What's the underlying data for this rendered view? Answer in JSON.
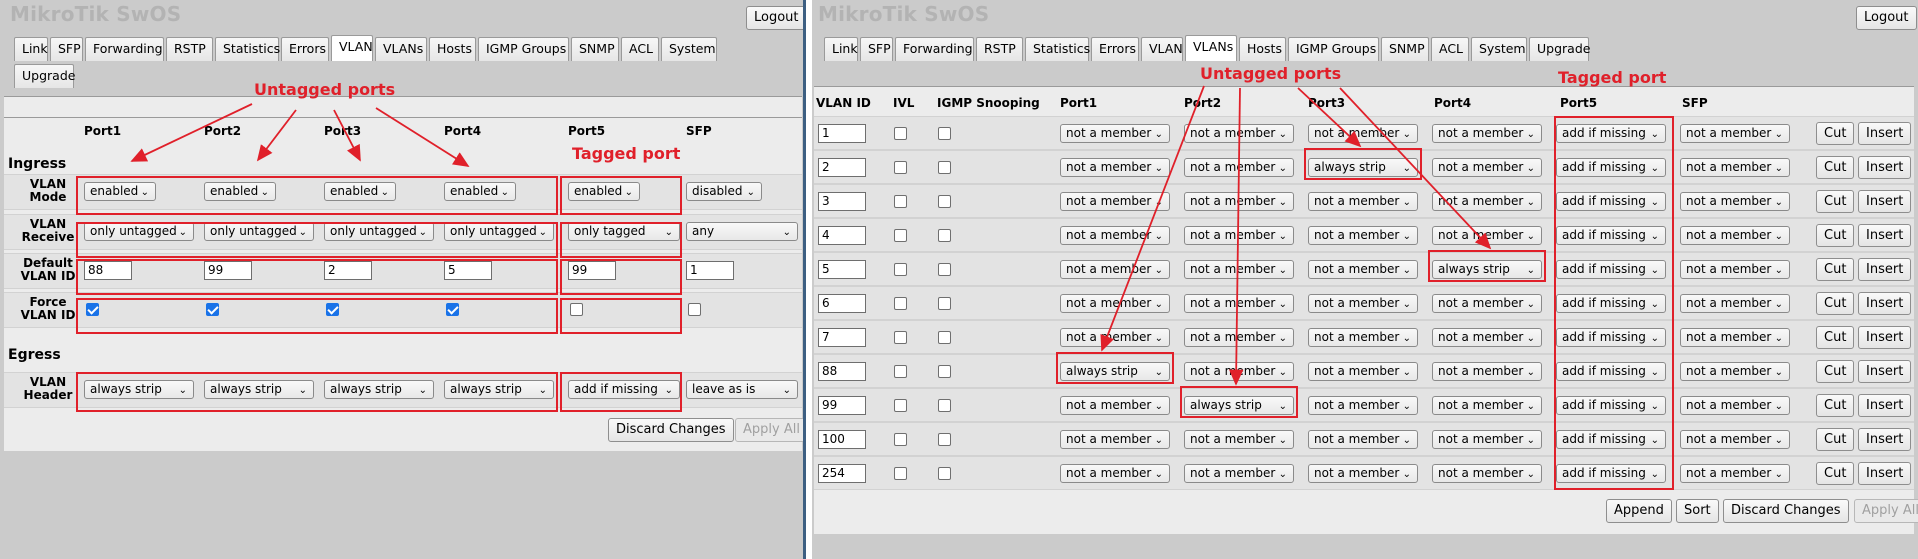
{
  "app_title": "MikroTik SwOS",
  "logout_label": "Logout",
  "left": {
    "tabs": [
      "Link",
      "SFP",
      "Forwarding",
      "RSTP",
      "Statistics",
      "Errors",
      "VLAN",
      "VLANs",
      "Hosts",
      "IGMP Groups",
      "SNMP",
      "ACL",
      "System",
      "Upgrade"
    ],
    "active_tab": "VLAN",
    "columns": [
      "Port1",
      "Port2",
      "Port3",
      "Port4",
      "Port5",
      "SFP"
    ],
    "ingress_label": "Ingress",
    "egress_label": "Egress",
    "rows": {
      "vlan_mode": {
        "label_1": "VLAN",
        "label_2": "Mode",
        "values": [
          "enabled",
          "enabled",
          "enabled",
          "enabled",
          "enabled",
          "disabled"
        ]
      },
      "vlan_receive": {
        "label_1": "VLAN",
        "label_2": "Receive",
        "values": [
          "only untagged",
          "only untagged",
          "only untagged",
          "only untagged",
          "only tagged",
          "any"
        ]
      },
      "default_vlan_id": {
        "label_1": "Default",
        "label_2": "VLAN ID",
        "values": [
          "88",
          "99",
          "2",
          "5",
          "99",
          "1"
        ]
      },
      "force_vlan_id": {
        "label_1": "Force",
        "label_2": "VLAN ID",
        "values": [
          true,
          true,
          true,
          true,
          false,
          false
        ]
      },
      "vlan_header": {
        "label_1": "VLAN",
        "label_2": "Header",
        "values": [
          "always strip",
          "always strip",
          "always strip",
          "always strip",
          "add if missing",
          "leave as is"
        ]
      }
    },
    "buttons": {
      "discard": "Discard Changes",
      "apply": "Apply All"
    },
    "annotations": {
      "untagged": "Untagged ports",
      "tagged": "Tagged port"
    }
  },
  "right": {
    "tabs": [
      "Link",
      "SFP",
      "Forwarding",
      "RSTP",
      "Statistics",
      "Errors",
      "VLAN",
      "VLANs",
      "Hosts",
      "IGMP Groups",
      "SNMP",
      "ACL",
      "System",
      "Upgrade"
    ],
    "active_tab": "VLANs",
    "columns": [
      "VLAN ID",
      "IVL",
      "IGMP Snooping",
      "Port1",
      "Port2",
      "Port3",
      "Port4",
      "Port5",
      "SFP"
    ],
    "rows": [
      {
        "vlan_id": "1",
        "ports": [
          "not a member",
          "not a member",
          "not a member",
          "not a member",
          "add if missing",
          "not a member"
        ]
      },
      {
        "vlan_id": "2",
        "ports": [
          "not a member",
          "not a member",
          "always strip",
          "not a member",
          "add if missing",
          "not a member"
        ]
      },
      {
        "vlan_id": "3",
        "ports": [
          "not a member",
          "not a member",
          "not a member",
          "not a member",
          "add if missing",
          "not a member"
        ]
      },
      {
        "vlan_id": "4",
        "ports": [
          "not a member",
          "not a member",
          "not a member",
          "not a member",
          "add if missing",
          "not a member"
        ]
      },
      {
        "vlan_id": "5",
        "ports": [
          "not a member",
          "not a member",
          "not a member",
          "always strip",
          "add if missing",
          "not a member"
        ]
      },
      {
        "vlan_id": "6",
        "ports": [
          "not a member",
          "not a member",
          "not a member",
          "not a member",
          "add if missing",
          "not a member"
        ]
      },
      {
        "vlan_id": "7",
        "ports": [
          "not a member",
          "not a member",
          "not a member",
          "not a member",
          "add if missing",
          "not a member"
        ]
      },
      {
        "vlan_id": "88",
        "ports": [
          "always strip",
          "not a member",
          "not a member",
          "not a member",
          "add if missing",
          "not a member"
        ]
      },
      {
        "vlan_id": "99",
        "ports": [
          "not a member",
          "always strip",
          "not a member",
          "not a member",
          "add if missing",
          "not a member"
        ]
      },
      {
        "vlan_id": "100",
        "ports": [
          "not a member",
          "not a member",
          "not a member",
          "not a member",
          "add if missing",
          "not a member"
        ]
      },
      {
        "vlan_id": "254",
        "ports": [
          "not a member",
          "not a member",
          "not a member",
          "not a member",
          "add if missing",
          "not a member"
        ]
      }
    ],
    "row_buttons": {
      "cut": "Cut",
      "insert": "Insert"
    },
    "buttons": {
      "append": "Append",
      "sort": "Sort",
      "discard": "Discard Changes",
      "apply": "Apply All"
    },
    "annotations": {
      "untagged": "Untagged ports",
      "tagged": "Tagged port"
    }
  }
}
